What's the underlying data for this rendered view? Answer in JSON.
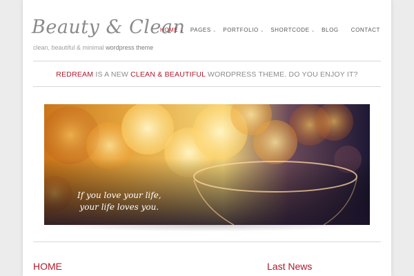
{
  "brand": {
    "logo_text": "Beauty & Clean",
    "tagline_plain": "clean, beautiful & minimal",
    "tagline_highlight": "wordpress theme"
  },
  "nav": {
    "items": [
      {
        "label": "HOME",
        "has_dropdown": true,
        "active": true
      },
      {
        "label": "PAGES",
        "has_dropdown": true,
        "active": false
      },
      {
        "label": "PORTFOLIO",
        "has_dropdown": true,
        "active": false
      },
      {
        "label": "SHORTCODE",
        "has_dropdown": true,
        "active": false
      },
      {
        "label": "BLOG",
        "has_dropdown": false,
        "active": false
      },
      {
        "label": "CONTACT",
        "has_dropdown": false,
        "active": false
      }
    ]
  },
  "announcement": {
    "part1": "REDREAM",
    "part2": " IS A NEW ",
    "part3": "CLEAN & BEAUTIFUL",
    "part4": " WORDPRESS THEME. DO YOU ENJOY IT?"
  },
  "slider": {
    "quote_line1": "If you love your life,",
    "quote_line2": "your life loves you."
  },
  "sections": {
    "left_title": "HOME",
    "right_title": "Last News"
  },
  "colors": {
    "accent": "#b0182a",
    "text_gray": "#8a8a8a",
    "background": "#ececec"
  },
  "icons": {
    "dropdown": "chevron-down-icon"
  }
}
